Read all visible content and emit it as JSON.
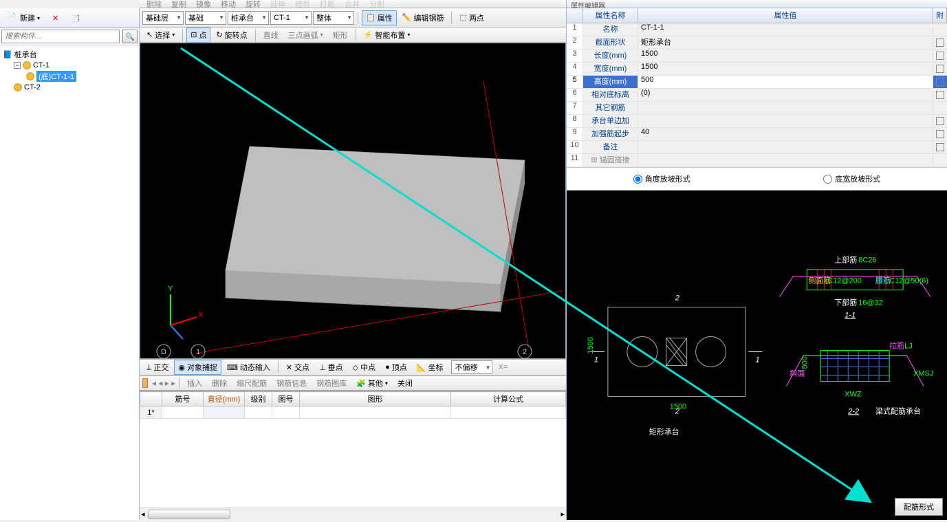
{
  "top_toolbars": {
    "row1": [
      {
        "label": "删除"
      },
      {
        "label": "复制"
      },
      {
        "label": "镜像"
      },
      {
        "label": "移动"
      },
      {
        "label": "旋转"
      },
      {
        "label": "延伸"
      },
      {
        "label": "修剪"
      },
      {
        "label": "打断"
      },
      {
        "label": "合并"
      },
      {
        "label": "分割"
      }
    ],
    "row2_dropdowns": [
      "基础层",
      "基础",
      "桩承台",
      "CT-1",
      "整体"
    ],
    "row2_buttons": [
      {
        "label": "属性"
      },
      {
        "label": "编辑钢筋"
      },
      {
        "label": "两点"
      }
    ],
    "row3": [
      {
        "label": "选择"
      },
      {
        "label": "点"
      },
      {
        "label": "旋转点"
      },
      {
        "label": "直线"
      },
      {
        "label": "三点画弧"
      },
      {
        "label": "矩形"
      },
      {
        "label": "智能布置"
      }
    ]
  },
  "left": {
    "new": "新建",
    "search_ph": "搜索构件...",
    "tree_root": "桩承台",
    "tree": [
      {
        "label": "CT-1",
        "children": [
          {
            "label": "(底)CT-1-1",
            "selected": true
          }
        ]
      },
      {
        "label": "CT-2"
      }
    ]
  },
  "snapbar": [
    {
      "label": "正交"
    },
    {
      "label": "对象捕捉"
    },
    {
      "label": "动态输入"
    },
    {
      "label": "交点"
    },
    {
      "label": "垂点"
    },
    {
      "label": "中点"
    },
    {
      "label": "顶点"
    },
    {
      "label": "坐标"
    }
  ],
  "snap_dd": "不偏移",
  "snap_x": "X=",
  "gridbar": [
    {
      "label": "插入"
    },
    {
      "label": "删除"
    },
    {
      "label": "缩尺配筋"
    },
    {
      "label": "钢筋信息"
    },
    {
      "label": "钢筋图库"
    },
    {
      "label": "其他"
    },
    {
      "label": "关闭"
    }
  ],
  "grid": {
    "headers": [
      "筋号",
      "直径(mm)",
      "级别",
      "图号",
      "图形",
      "计算公式"
    ],
    "row_label": "1*"
  },
  "props": {
    "title": "属性编辑器",
    "head": [
      "",
      "属性名称",
      "属性值",
      "附"
    ],
    "rows": [
      {
        "n": "1",
        "name": "名称",
        "val": "CT-1-1",
        "ck": false
      },
      {
        "n": "2",
        "name": "截面形状",
        "val": "矩形承台",
        "ck": true
      },
      {
        "n": "3",
        "name": "长度(mm)",
        "val": "1500",
        "ck": true
      },
      {
        "n": "4",
        "name": "宽度(mm)",
        "val": "1500",
        "ck": true
      },
      {
        "n": "5",
        "name": "高度(mm)",
        "val": "500",
        "ck": true,
        "sel": true
      },
      {
        "n": "6",
        "name": "相对底标高",
        "val": "(0)",
        "ck": true
      },
      {
        "n": "7",
        "name": "其它钢筋",
        "val": "",
        "ck": false
      },
      {
        "n": "8",
        "name": "承台单边加",
        "val": "",
        "ck": true
      },
      {
        "n": "9",
        "name": "加强筋起步",
        "val": "40",
        "ck": true
      },
      {
        "n": "10",
        "name": "备注",
        "val": "",
        "ck": true
      },
      {
        "n": "11",
        "name": "锚固搭接",
        "val": "",
        "ck": false,
        "gray": true,
        "plus": true
      }
    ]
  },
  "radios": {
    "a": "角度放坡形式",
    "b": "底宽放坡形式"
  },
  "diagram": {
    "plan_label": "矩形承台",
    "sec11": "1-1",
    "sec22": "2-2",
    "beam_label": "梁式配筋承台",
    "up_label": "上部筋",
    "up_spec": "8C26",
    "side_label": "侧面筋",
    "side_spec": "C12@200",
    "waist_label": "腰筋",
    "waist_spec": "C12@50(6)",
    "down_label": "下部筋",
    "down_spec": "16@32",
    "rib_label": "拉筋",
    "rib_spec": "LJ",
    "slope_label": "斜面",
    "xwz": "XWZ",
    "xmsj": "XMSJ",
    "dim1500a": "1500",
    "dim1500b": "1500",
    "dim500": "500",
    "btn": "配筋形式"
  }
}
